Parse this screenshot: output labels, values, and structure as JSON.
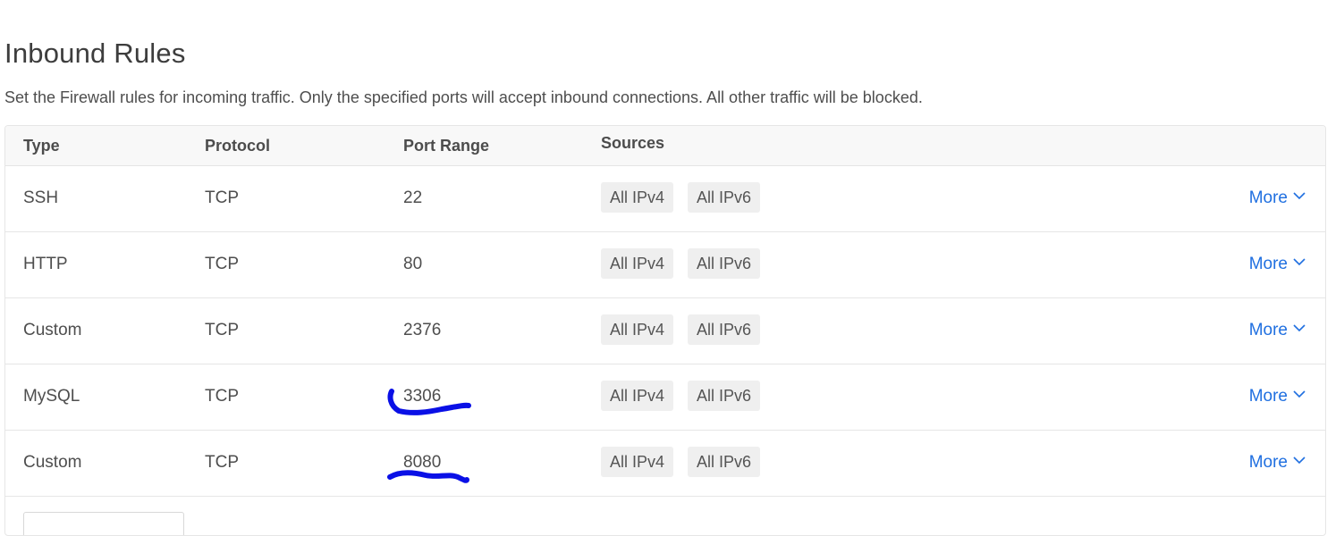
{
  "page": {
    "title": "Inbound Rules",
    "description": "Set the Firewall rules for incoming traffic. Only the specified ports will accept inbound connections. All other traffic will be blocked."
  },
  "table": {
    "headers": {
      "type": "Type",
      "protocol": "Protocol",
      "port_range": "Port Range",
      "sources": "Sources"
    },
    "rows": [
      {
        "type": "SSH",
        "protocol": "TCP",
        "port": "22",
        "sources": [
          "All IPv4",
          "All IPv6"
        ],
        "action": "More"
      },
      {
        "type": "HTTP",
        "protocol": "TCP",
        "port": "80",
        "sources": [
          "All IPv4",
          "All IPv6"
        ],
        "action": "More"
      },
      {
        "type": "Custom",
        "protocol": "TCP",
        "port": "2376",
        "sources": [
          "All IPv4",
          "All IPv6"
        ],
        "action": "More"
      },
      {
        "type": "MySQL",
        "protocol": "TCP",
        "port": "3306",
        "sources": [
          "All IPv4",
          "All IPv6"
        ],
        "action": "More"
      },
      {
        "type": "Custom",
        "protocol": "TCP",
        "port": "8080",
        "sources": [
          "All IPv4",
          "All IPv6"
        ],
        "action": "More"
      }
    ]
  },
  "colors": {
    "link": "#1f6fe0",
    "annotation": "#0a10e6"
  },
  "icons": {
    "more_chevron": "chevron-down-icon"
  }
}
